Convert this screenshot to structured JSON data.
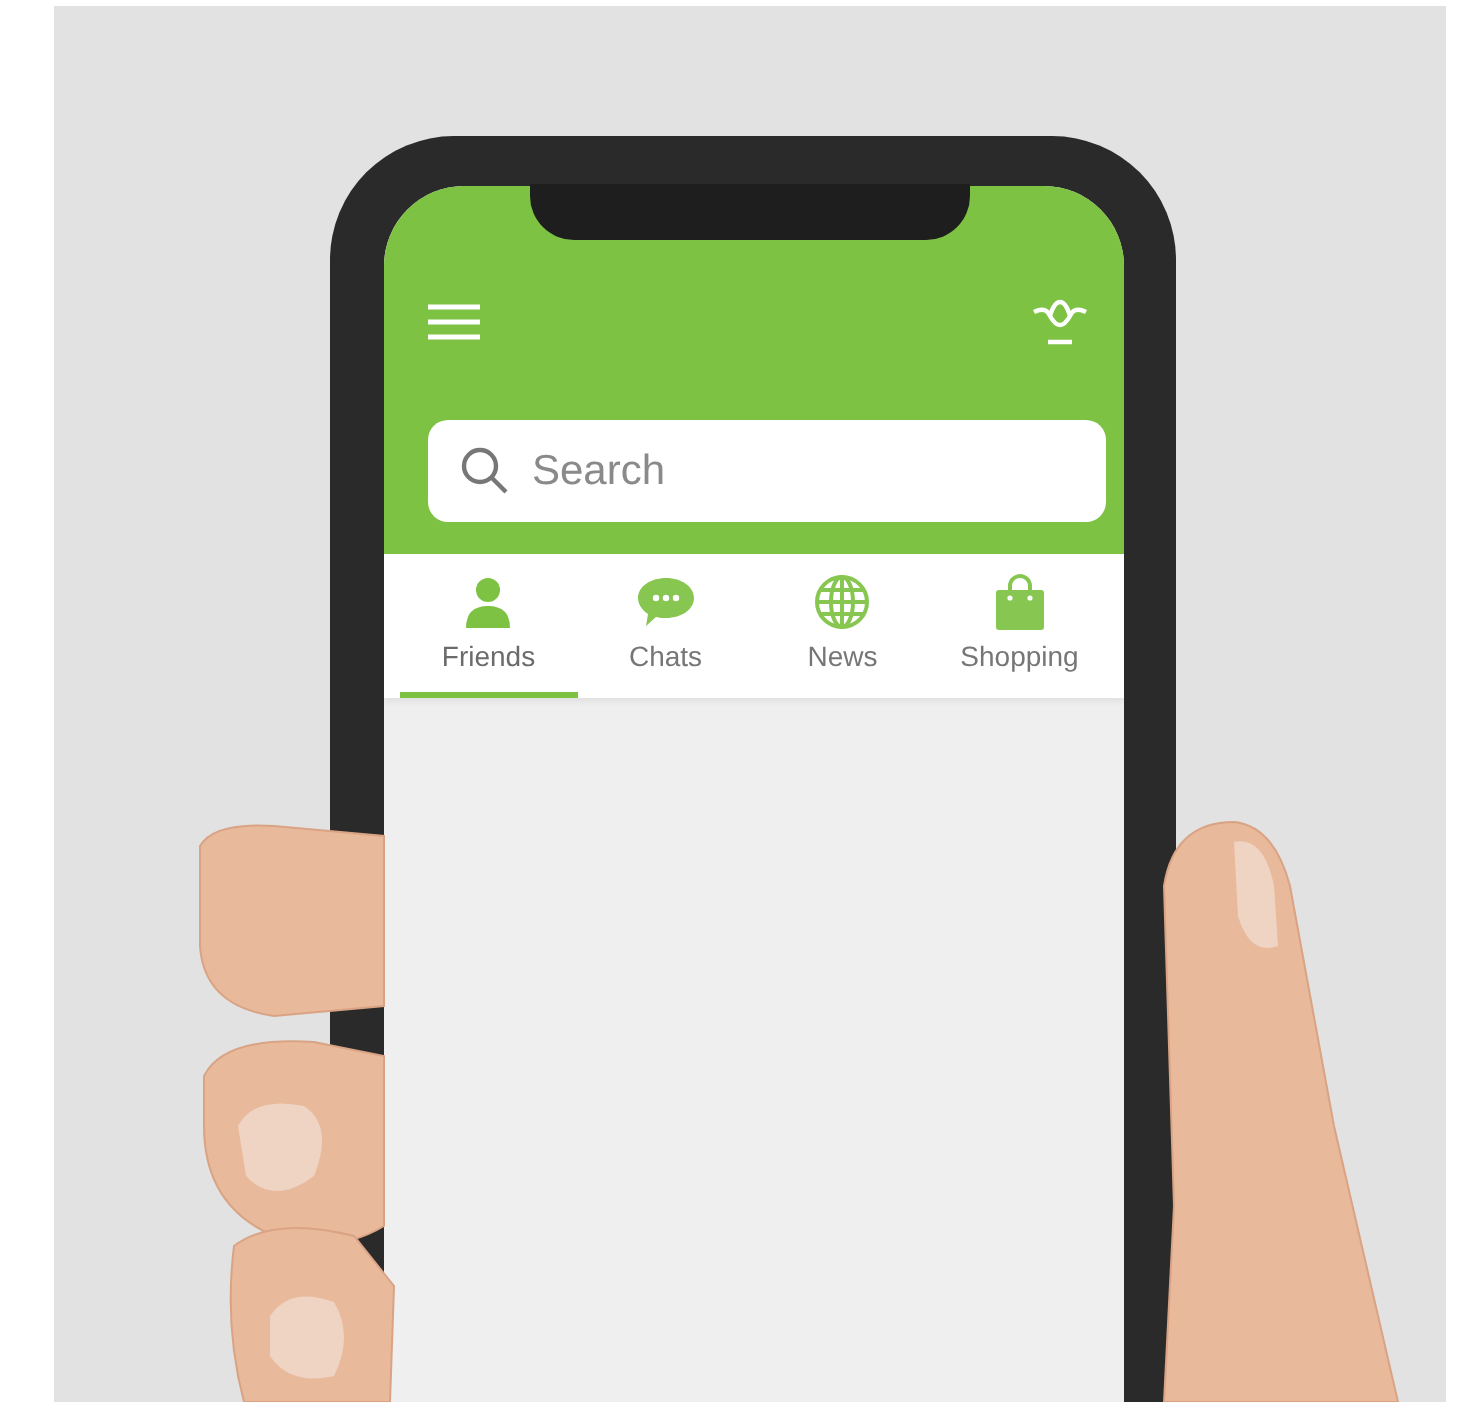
{
  "search": {
    "placeholder": "Search"
  },
  "tabs": [
    {
      "label": "Friends",
      "selected": true,
      "kind": "person"
    },
    {
      "label": "Chats",
      "selected": false,
      "kind": "chat"
    },
    {
      "label": "News",
      "selected": false,
      "kind": "globe"
    },
    {
      "label": "Shopping",
      "selected": false,
      "kind": "bag"
    }
  ]
}
